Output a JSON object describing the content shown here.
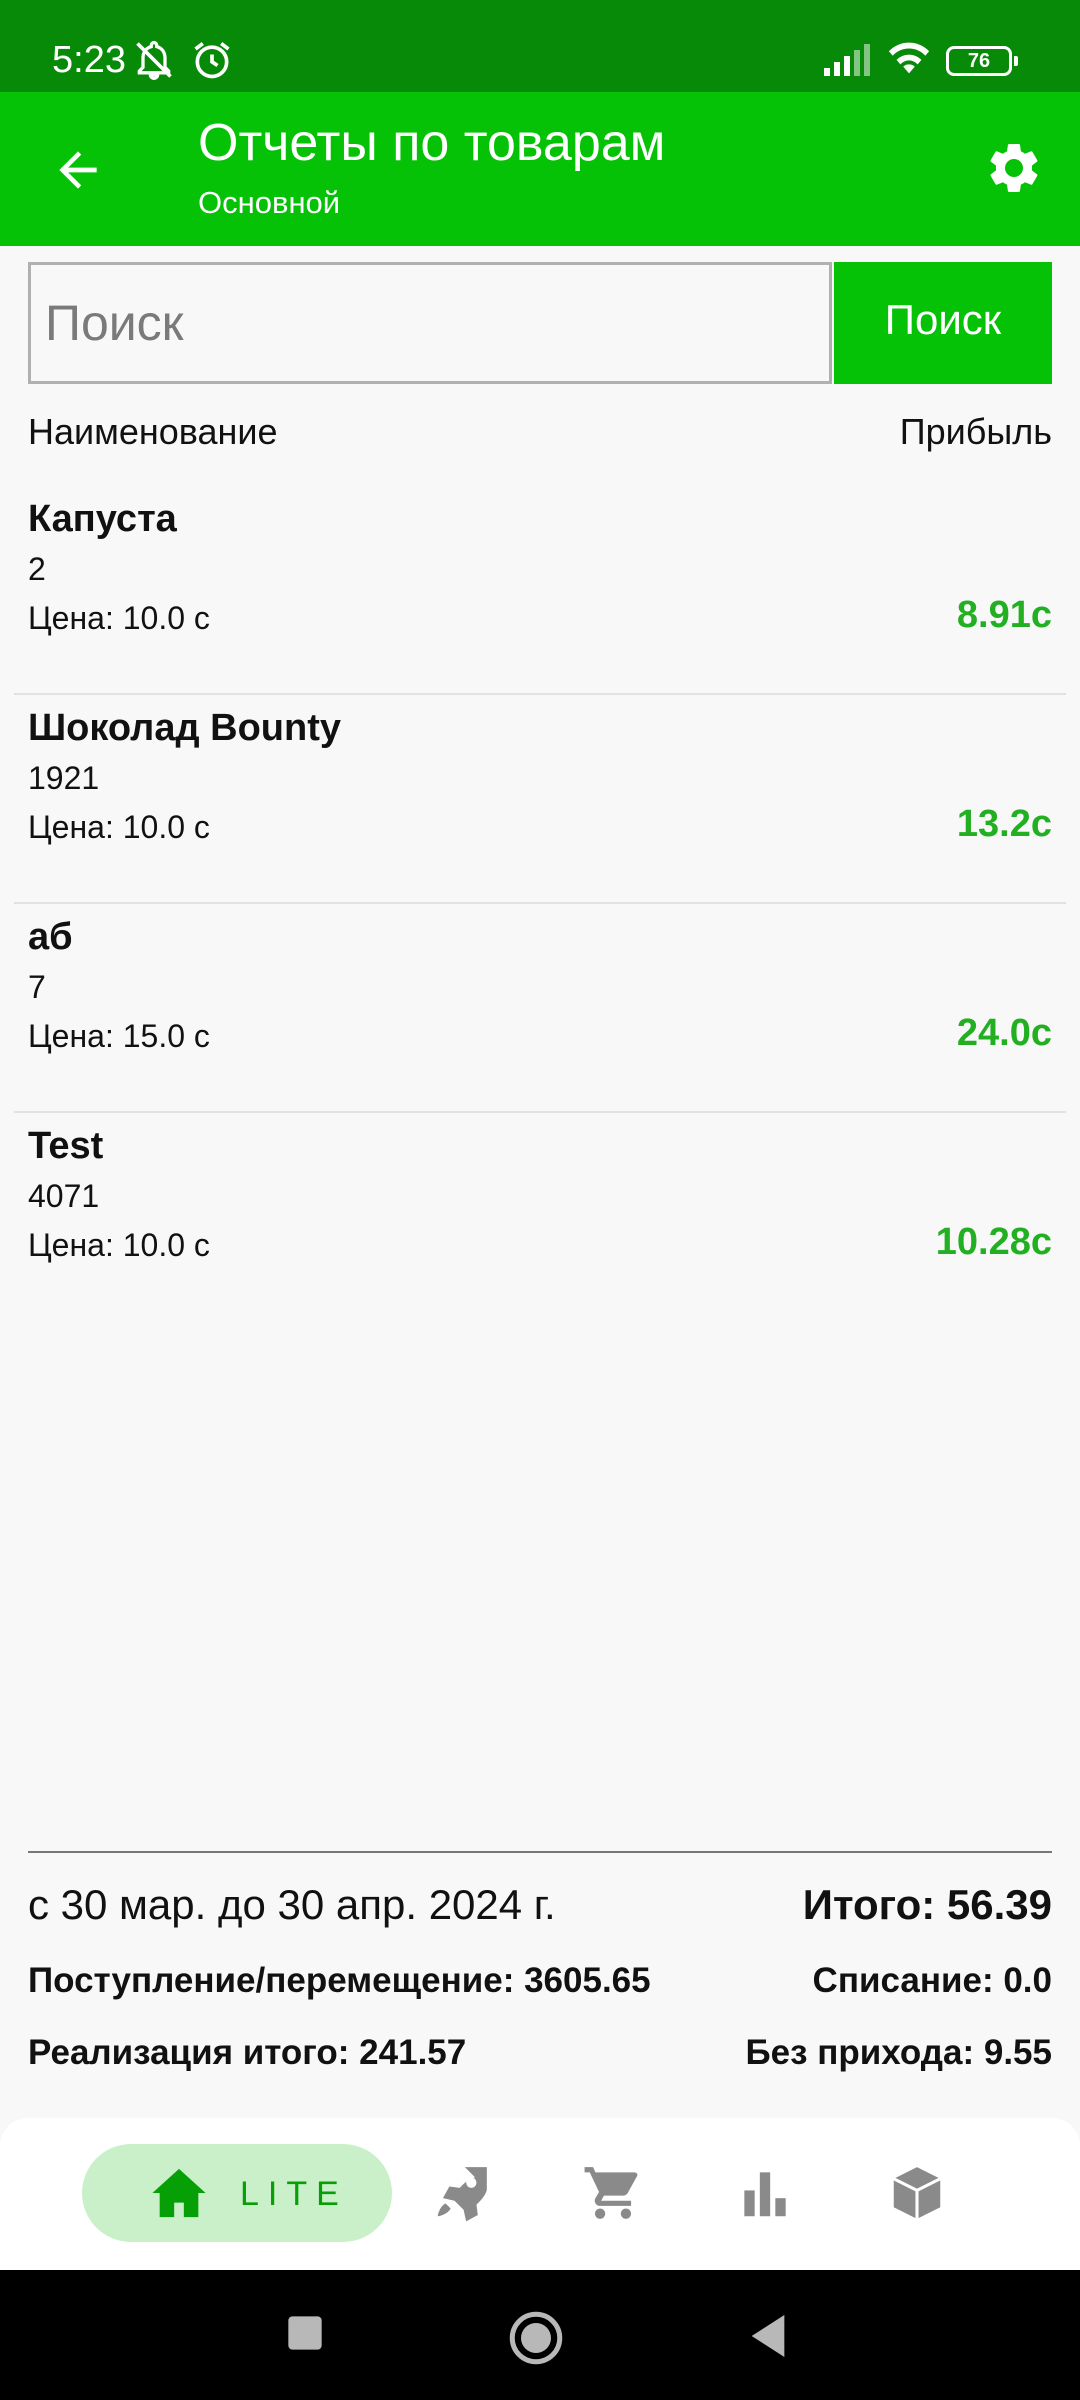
{
  "status_bar": {
    "time": "5:23",
    "battery": "76",
    "icons": [
      "notifications-off-icon",
      "alarm-icon",
      "signal-icon",
      "wifi-icon",
      "battery-icon"
    ]
  },
  "app_bar": {
    "title": "Отчеты по товарам",
    "subtitle": "Основной",
    "back_icon": "arrow-left-icon",
    "settings_icon": "gear-icon",
    "color": "#06c206"
  },
  "search": {
    "placeholder": "Поиск",
    "value": "",
    "button_label": "Поиск"
  },
  "columns": {
    "name": "Наименование",
    "profit": "Прибыль"
  },
  "items": [
    {
      "name": "Капуста",
      "qty": "2",
      "price": "Цена: 10.0 с",
      "profit": "8.91с"
    },
    {
      "name": "Шоколад Bounty",
      "qty": "1921",
      "price": "Цена: 10.0 с",
      "profit": "13.2с"
    },
    {
      "name": "аб",
      "qty": "7",
      "price": "Цена: 15.0 с",
      "profit": "24.0с"
    },
    {
      "name": "Test",
      "qty": "4071",
      "price": "Цена: 10.0 с",
      "profit": "10.28с"
    }
  ],
  "summary": {
    "period": "с 30 мар. до 30 апр. 2024 г.",
    "total": "Итого: 56.39",
    "incoming": "Поступление/перемещение: 3605.65",
    "writeoff": "Списание: 0.0",
    "sales_total": "Реализация итого: 241.57",
    "no_income": "Без прихода: 9.55"
  },
  "bottom_nav": {
    "home_label": "LITE",
    "items": [
      "home-icon",
      "rocket-icon",
      "cart-icon",
      "bar-chart-icon",
      "box-icon"
    ],
    "active_color": "#c9f0c9"
  },
  "colors": {
    "status_bar": "#078a07",
    "accent": "#06c206",
    "profit": "#22b022"
  }
}
